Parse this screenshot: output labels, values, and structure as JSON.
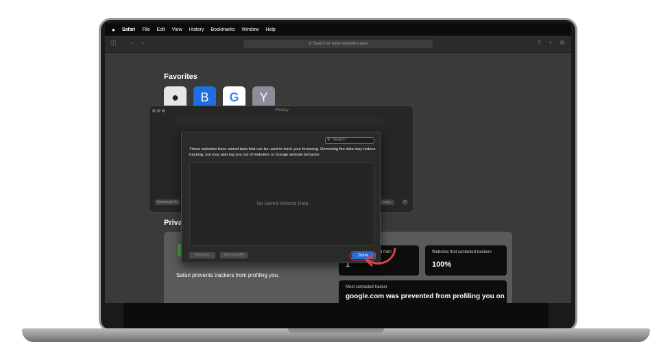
{
  "menubar": {
    "apple_icon": "apple-icon",
    "items": [
      "Safari",
      "File",
      "Edit",
      "View",
      "History",
      "Bookmarks",
      "Window",
      "Help"
    ]
  },
  "toolbar": {
    "address_placeholder": "Search or enter website name"
  },
  "favorites": {
    "title": "Favorites",
    "items": [
      {
        "glyph": "",
        "color": "#e6e6e6",
        "icon": "apple-icon"
      },
      {
        "glyph": "B",
        "color": "#1f6fe0"
      },
      {
        "glyph": "G",
        "color": "#ffffff"
      },
      {
        "glyph": "Y",
        "color": "#8c8c9a"
      }
    ]
  },
  "privacy_window": {
    "title": "Privacy",
    "advanced_label": "Advanced Se",
    "privacy_btn_label": "ivacy...",
    "help_label": "?"
  },
  "sheet": {
    "search_placeholder": "Search",
    "description": "These websites have stored data that can be used to track your browsing. Removing the data may reduce tracking, but may also log you out of websites or change website behavior.",
    "empty_message": "No Saved Website Data",
    "remove_label": "Remove",
    "remove_all_label": "Remove All",
    "done_label": "Done"
  },
  "privacy_report": {
    "title": "Privac",
    "message": "Safari prevents trackers from profiling you.",
    "stat1_label": "d from",
    "stat1_value": "1",
    "stat2_label": "Websites that contacted trackers",
    "stat2_value": "100%",
    "most_label": "Most contacted tracker",
    "most_value": "google.com was prevented from profiling you on"
  },
  "colors": {
    "accent": "#2a6fd6",
    "highlight": "#d94444"
  }
}
